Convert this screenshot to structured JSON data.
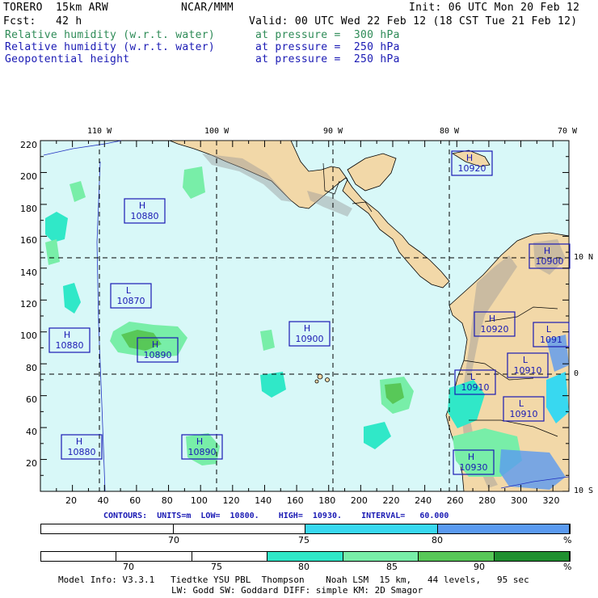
{
  "header": {
    "model": "TORERO  15km ARW",
    "org": "NCAR/MMM",
    "init": "Init: 06 UTC Mon 20 Feb 12",
    "fcst": "Fcst:   42 h",
    "valid": "Valid: 00 UTC Wed 22 Feb 12 (18 CST Tue 21 Feb 12)",
    "fields": [
      {
        "name": "Relative humidity (w.r.t. water)",
        "level": "at pressure =  300 hPa",
        "color": "#2e8b57"
      },
      {
        "name": "Relative humidity (w.r.t. water)",
        "level": "at pressure =  250 hPa",
        "color": "#1a1ab4"
      },
      {
        "name": "Geopotential height",
        "level": "at pressure =  250 hPa",
        "color": "#1a1ab4"
      }
    ]
  },
  "map": {
    "lon_labels": [
      "110 W",
      "100 W",
      "90 W",
      "80 W",
      "70 W"
    ],
    "lat_labels": [
      "10 N",
      "0",
      "10 S"
    ],
    "y_ticks": [
      "220",
      "200",
      "180",
      "160",
      "140",
      "120",
      "100",
      "80",
      "60",
      "40",
      "20"
    ],
    "x_ticks": [
      "20",
      "40",
      "60",
      "80",
      "100",
      "120",
      "140",
      "160",
      "180",
      "200",
      "220",
      "240",
      "260",
      "280",
      "300",
      "320"
    ],
    "ocean_color": "#d8f8f8",
    "land_color": "#f2d8a8",
    "pressure_centers": [
      {
        "type": "H",
        "value": "10920"
      },
      {
        "type": "H",
        "value": "10880"
      },
      {
        "type": "H",
        "value": "10900"
      },
      {
        "type": "L",
        "value": "10870"
      },
      {
        "type": "H",
        "value": "10880"
      },
      {
        "type": "H",
        "value": "10890"
      },
      {
        "type": "H",
        "value": "10900"
      },
      {
        "type": "H",
        "value": "10920"
      },
      {
        "type": "L",
        "value": "1091"
      },
      {
        "type": "L",
        "value": "10910"
      },
      {
        "type": "L",
        "value": "10910"
      },
      {
        "type": "L",
        "value": "10910"
      },
      {
        "type": "H",
        "value": "10880"
      },
      {
        "type": "H",
        "value": "10890"
      },
      {
        "type": "H",
        "value": "10930"
      }
    ]
  },
  "contours": "CONTOURS:  UNITS=m  LOW=  10800.    HIGH=  10930.    INTERVAL=   60.000",
  "colorbar1": {
    "labels": [
      "70",
      "75",
      "80",
      "%"
    ],
    "colors": [
      "#ffffff",
      "#ffffff",
      "#38d8f0",
      "#5a9af0"
    ]
  },
  "colorbar2": {
    "labels": [
      "70",
      "75",
      "80",
      "85",
      "90",
      "%"
    ],
    "colors": [
      "#ffffff",
      "#ffffff",
      "#ffffff",
      "#30e8c8",
      "#78eea8",
      "#58c858",
      "#209030"
    ]
  },
  "footer": {
    "line1": "Model Info: V3.3.1   Tiedtke YSU PBL  Thompson    Noah LSM  15 km,   44 levels,   95 sec",
    "line2": "LW: Godd SW: Goddard DIFF: simple KM: 2D Smagor"
  }
}
